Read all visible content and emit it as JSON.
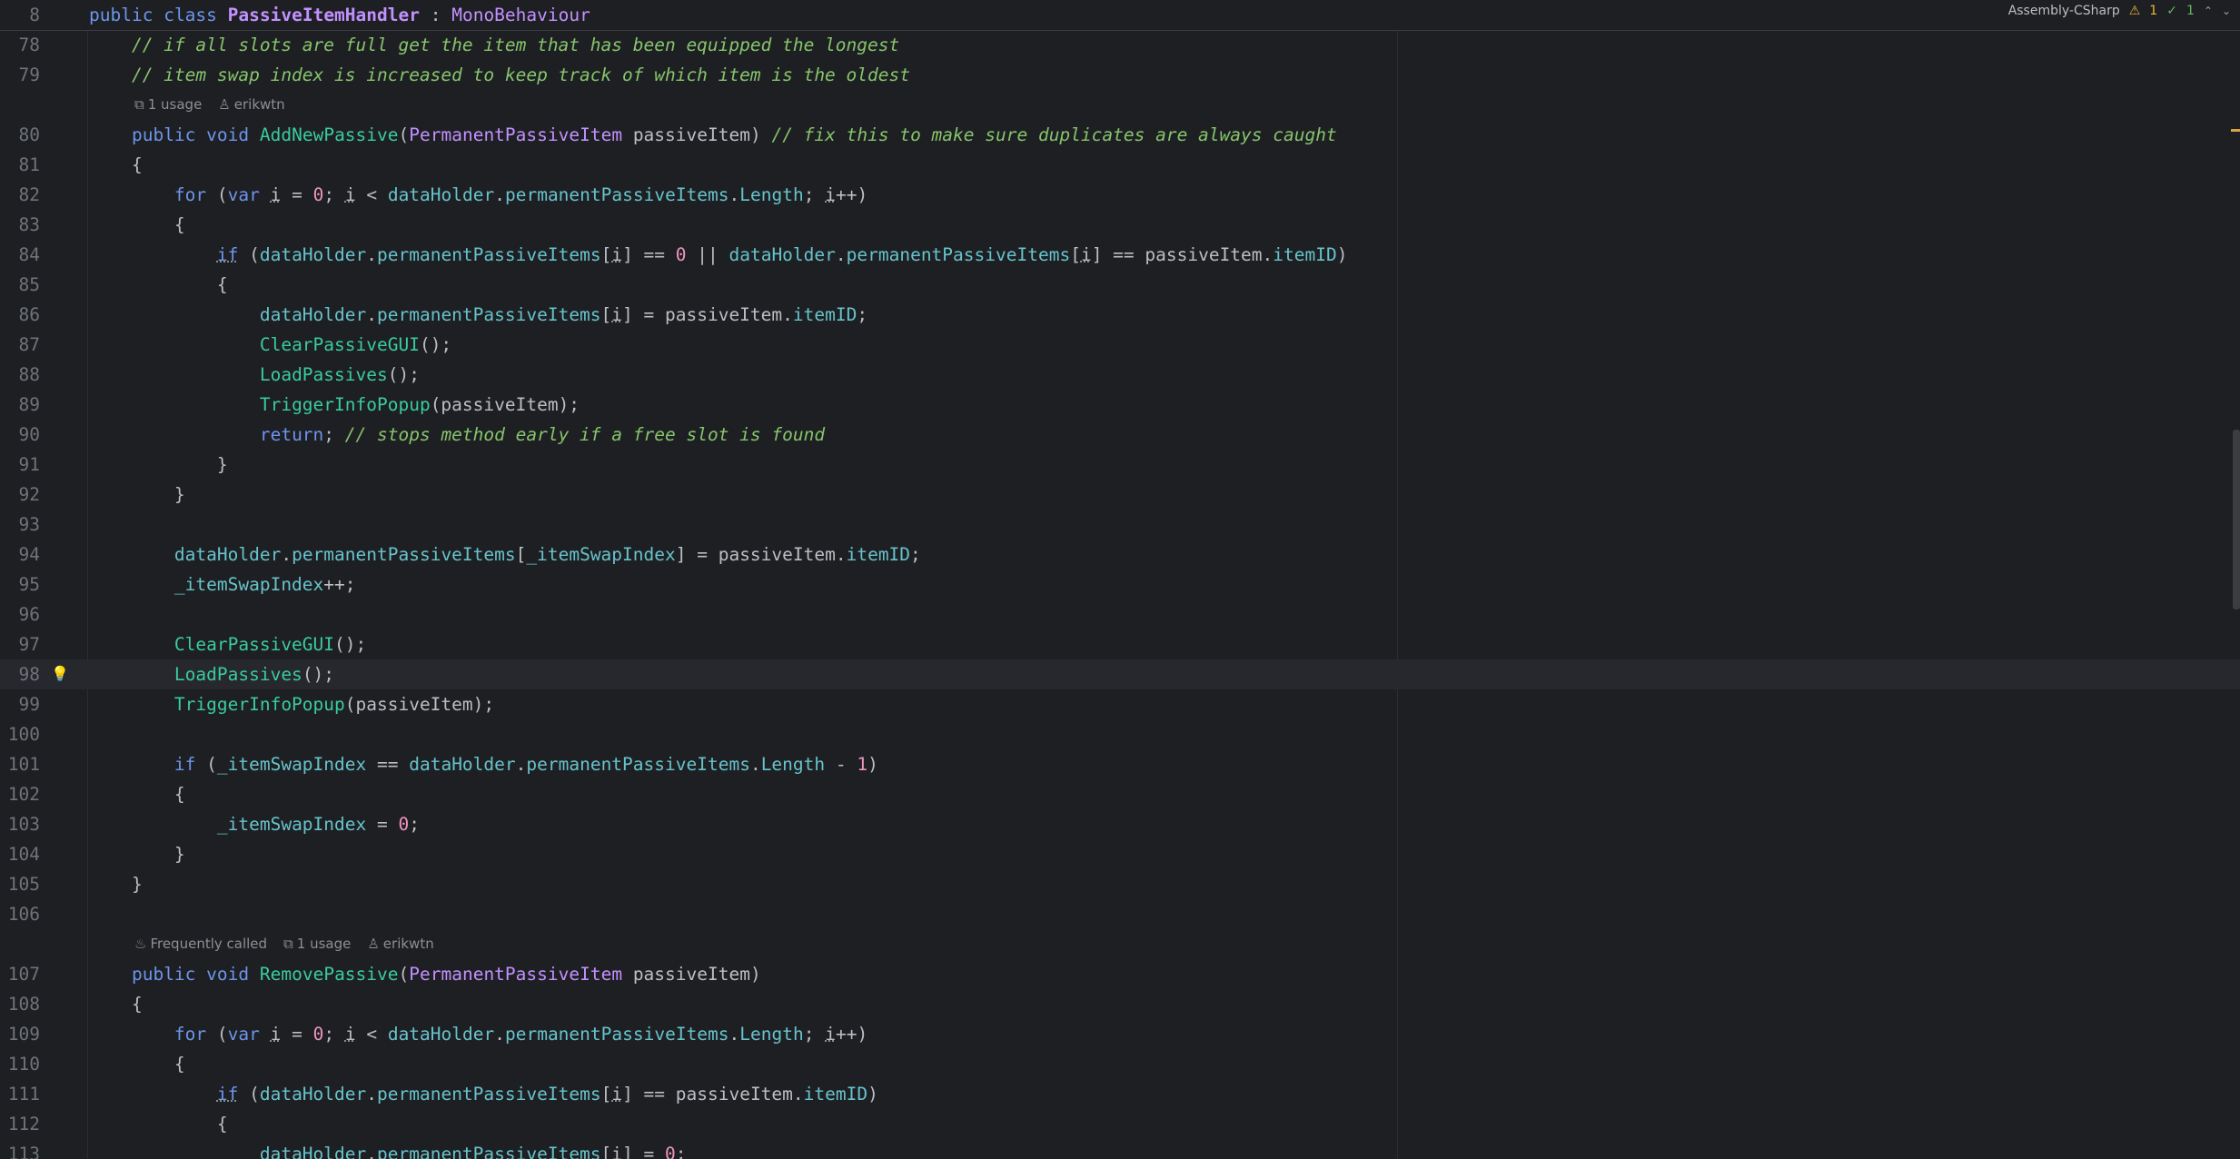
{
  "sticky": {
    "line_number": "8",
    "code": "public class PassiveItemHandler : MonoBehaviour"
  },
  "top_right": {
    "project": "Assembly-CSharp",
    "warnings": "1",
    "checks": "1"
  },
  "hints": {
    "add_new_passive": {
      "usages": "1 usage",
      "author": "erikwtn"
    },
    "remove_passive": {
      "frequency": "Frequently called",
      "usages": "1 usage",
      "author": "erikwtn"
    }
  },
  "lines": [
    {
      "n": "78",
      "text": "    // if all slots are full get the item that has been equipped the longest"
    },
    {
      "n": "79",
      "text": "    // item swap index is increased to keep track of which item is the oldest"
    },
    {
      "n": "80",
      "text": "    public void AddNewPassive(PermanentPassiveItem passiveItem) // fix this to make sure duplicates are always caught"
    },
    {
      "n": "81",
      "text": "    {"
    },
    {
      "n": "82",
      "text": "        for (var i = 0; i < dataHolder.permanentPassiveItems.Length; i++)"
    },
    {
      "n": "83",
      "text": "        {"
    },
    {
      "n": "84",
      "text": "            if (dataHolder.permanentPassiveItems[i] == 0 || dataHolder.permanentPassiveItems[i] == passiveItem.itemID)"
    },
    {
      "n": "85",
      "text": "            {"
    },
    {
      "n": "86",
      "text": "                dataHolder.permanentPassiveItems[i] = passiveItem.itemID;"
    },
    {
      "n": "87",
      "text": "                ClearPassiveGUI();"
    },
    {
      "n": "88",
      "text": "                LoadPassives();"
    },
    {
      "n": "89",
      "text": "                TriggerInfoPopup(passiveItem);"
    },
    {
      "n": "90",
      "text": "                return; // stops method early if a free slot is found"
    },
    {
      "n": "91",
      "text": "            }"
    },
    {
      "n": "92",
      "text": "        }"
    },
    {
      "n": "93",
      "text": ""
    },
    {
      "n": "94",
      "text": "        dataHolder.permanentPassiveItems[_itemSwapIndex] = passiveItem.itemID;"
    },
    {
      "n": "95",
      "text": "        _itemSwapIndex++;"
    },
    {
      "n": "96",
      "text": ""
    },
    {
      "n": "97",
      "text": "        ClearPassiveGUI();"
    },
    {
      "n": "98",
      "text": "        LoadPassives();"
    },
    {
      "n": "99",
      "text": "        TriggerInfoPopup(passiveItem);"
    },
    {
      "n": "100",
      "text": ""
    },
    {
      "n": "101",
      "text": "        if (_itemSwapIndex == dataHolder.permanentPassiveItems.Length - 1)"
    },
    {
      "n": "102",
      "text": "        {"
    },
    {
      "n": "103",
      "text": "            _itemSwapIndex = 0;"
    },
    {
      "n": "104",
      "text": "        }"
    },
    {
      "n": "105",
      "text": "    }"
    },
    {
      "n": "106",
      "text": ""
    },
    {
      "n": "107",
      "text": "    public void RemovePassive(PermanentPassiveItem passiveItem)"
    },
    {
      "n": "108",
      "text": "    {"
    },
    {
      "n": "109",
      "text": "        for (var i = 0; i < dataHolder.permanentPassiveItems.Length; i++)"
    },
    {
      "n": "110",
      "text": "        {"
    },
    {
      "n": "111",
      "text": "            if (dataHolder.permanentPassiveItems[i] == passiveItem.itemID)"
    },
    {
      "n": "112",
      "text": "            {"
    },
    {
      "n": "113",
      "text": "                dataHolder.permanentPassiveItems[i] = 0;"
    }
  ],
  "colors": {
    "background": "#1e1f22",
    "keyword": "#6c95eb",
    "class": "#c191ff",
    "method": "#39cc9b",
    "field": "#66c3cc",
    "number": "#ed94c0",
    "comment": "#85c46c",
    "warning": "#e8b63a"
  }
}
